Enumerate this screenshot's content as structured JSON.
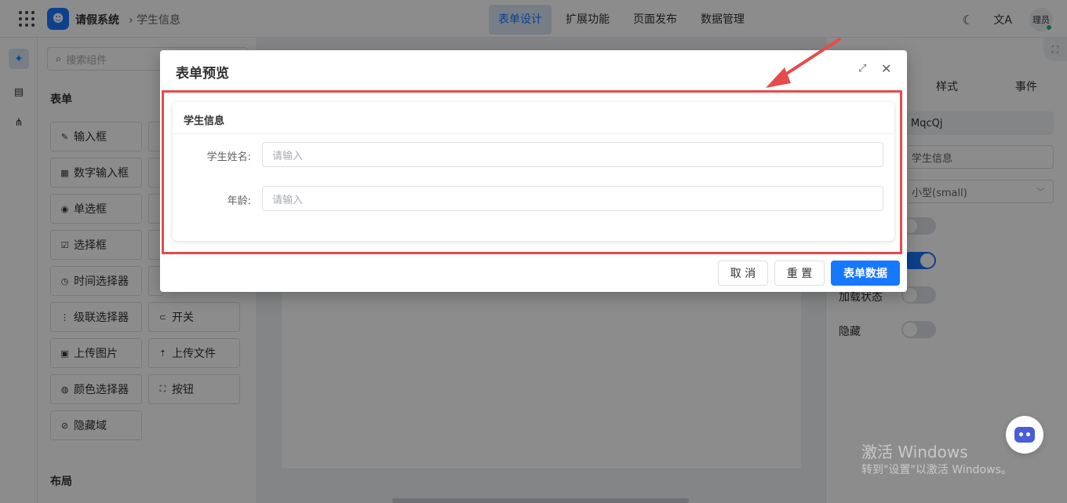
{
  "topbar": {
    "app_title": "请假系统",
    "breadcrumb": "学生信息",
    "tabs": [
      {
        "label": "表单设计",
        "active": true
      },
      {
        "label": "扩展功能",
        "active": false
      },
      {
        "label": "页面发布",
        "active": false
      },
      {
        "label": "数据管理",
        "active": false
      }
    ],
    "avatar_text": "理员",
    "translate_glyph": "文A"
  },
  "components": {
    "search_placeholder": "搜索组件",
    "section_form": "表单",
    "section_layout": "布局",
    "items": [
      {
        "label": "输入框",
        "icon": "✎"
      },
      {
        "label": "数字输入框",
        "icon": "▦"
      },
      {
        "label": "单选框",
        "icon": "◉"
      },
      {
        "label": "选择框",
        "icon": "☑"
      },
      {
        "label": "时间选择器",
        "icon": "◷"
      },
      {
        "label": "级联选择器",
        "icon": "⋮"
      },
      {
        "label": "开关",
        "icon": "⊂"
      },
      {
        "label": "上传图片",
        "icon": "▣"
      },
      {
        "label": "上传文件",
        "icon": "⇡"
      },
      {
        "label": "颜色选择器",
        "icon": "◍"
      },
      {
        "label": "按钮",
        "icon": "⛶"
      },
      {
        "label": "隐藏域",
        "icon": "⊘"
      }
    ]
  },
  "props": {
    "tabs": [
      "样式",
      "事件"
    ],
    "id_value": "MqcQj",
    "title_value": "学生信息",
    "size_value": "小型(small)",
    "loading_label": "加载状态",
    "hidden_label": "隐藏"
  },
  "watermark": {
    "line1": "激活 Windows",
    "line2": "转到\"设置\"以激活 Windows。"
  },
  "modal": {
    "title": "表单预览",
    "card_title": "学生信息",
    "fields": [
      {
        "label": "学生姓名:",
        "placeholder": "请输入"
      },
      {
        "label": "年龄:",
        "placeholder": "请输入"
      }
    ],
    "cancel_label": "取 消",
    "reset_label": "重 置",
    "submit_label": "表单数据"
  },
  "colors": {
    "primary": "#1677ff",
    "highlight": "#e64b4b"
  }
}
